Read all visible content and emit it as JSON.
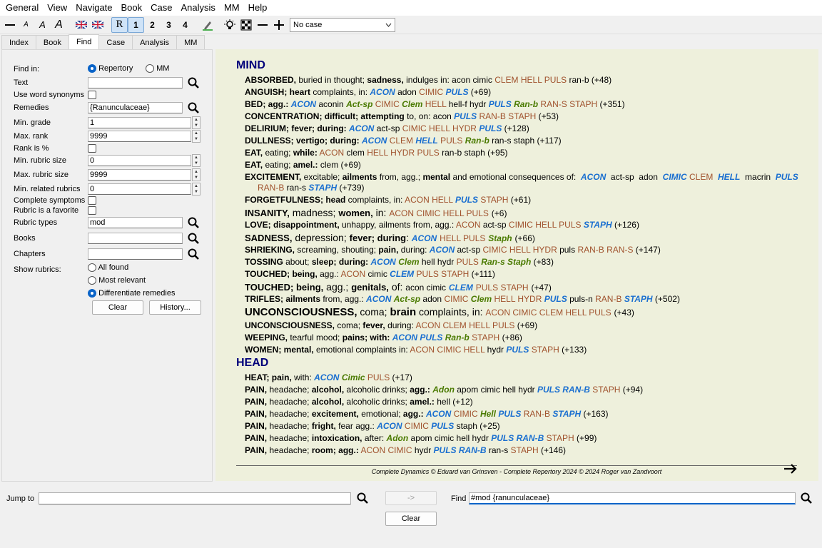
{
  "menu": [
    "General",
    "View",
    "Navigate",
    "Book",
    "Case",
    "Analysis",
    "MM",
    "Help"
  ],
  "toolbar": {
    "grade_buttons": [
      "R",
      "1",
      "2",
      "3",
      "4"
    ],
    "case_select": "No case"
  },
  "tabs": [
    "Index",
    "Book",
    "Find",
    "Case",
    "Analysis",
    "MM"
  ],
  "find": {
    "find_in_label": "Find in:",
    "opt_repertory": "Repertory",
    "opt_mm": "MM",
    "text_label": "Text",
    "text_value": "",
    "synonyms_label": "Use word synonyms",
    "remedies_label": "Remedies",
    "remedies_value": "{Ranunculaceae}",
    "min_grade_label": "Min. grade",
    "min_grade_value": "1",
    "max_rank_label": "Max. rank",
    "max_rank_value": "9999",
    "rank_pct_label": "Rank is %",
    "min_rubric_label": "Min. rubric size",
    "min_rubric_value": "0",
    "max_rubric_label": "Max. rubric size",
    "max_rubric_value": "9999",
    "min_related_label": "Min. related rubrics",
    "min_related_value": "0",
    "complete_label": "Complete symptoms",
    "favorite_label": "Rubric is a favorite",
    "rubric_types_label": "Rubric types",
    "rubric_types_value": "mod",
    "books_label": "Books",
    "chapters_label": "Chapters",
    "show_label": "Show rubrics:",
    "show_all": "All found",
    "show_relevant": "Most relevant",
    "show_diff": "Differentiate remedies",
    "clear": "Clear",
    "history": "History..."
  },
  "results": {
    "chapter_mind": "MIND",
    "chapter_head": "HEAD",
    "footer": "Complete Dynamics © Eduard van Grinsven   -   Complete Repertory 2024 © 2024 Roger van Zandvoort"
  },
  "bottom": {
    "jump_label": "Jump to",
    "jump_value": "",
    "go_button": "->",
    "find_label": "Find",
    "find_value": "#mod {ranunculaceae}",
    "clear": "Clear"
  }
}
